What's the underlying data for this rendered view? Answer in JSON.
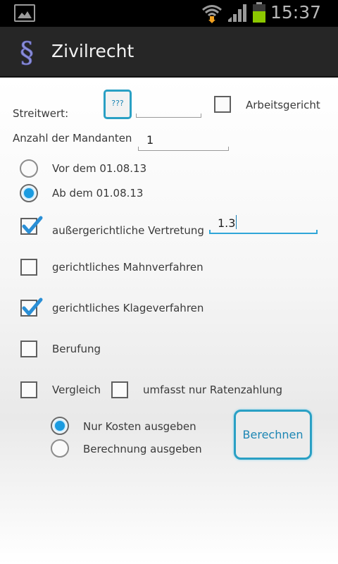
{
  "status_bar": {
    "time": "15:37"
  },
  "app": {
    "title": "Zivilrecht"
  },
  "streitwert": {
    "label": "Streitwert:",
    "help_button": "???",
    "value": ""
  },
  "arbeitsgericht": {
    "label": "Arbeitsgericht",
    "checked": false
  },
  "mandanten": {
    "label": "Anzahl der Mandanten",
    "value": "1"
  },
  "date_options": [
    {
      "label": "Vor dem 01.08.13",
      "selected": false
    },
    {
      "label": "Ab dem 01.08.13",
      "selected": true
    }
  ],
  "procedures": [
    {
      "label": "außergerichtliche Vertretung",
      "checked": true,
      "factor": "1.3"
    },
    {
      "label": "gerichtliches Mahnverfahren",
      "checked": false
    },
    {
      "label": "gerichtliches Klageverfahren",
      "checked": true
    },
    {
      "label": "Berufung",
      "checked": false
    }
  ],
  "vergleich": {
    "label": "Vergleich",
    "checked": false
  },
  "ratenzahlung": {
    "label": "umfasst nur Ratenzahlung",
    "checked": false
  },
  "output_options": [
    {
      "label": "Nur Kosten ausgeben",
      "selected": true
    },
    {
      "label": "Berechnung ausgeben",
      "selected": false
    }
  ],
  "calculate_button": "Berechnen",
  "colors": {
    "accent": "#2aa0c4",
    "radio_selected": "#1a9be0",
    "actionbar": "#262626"
  }
}
